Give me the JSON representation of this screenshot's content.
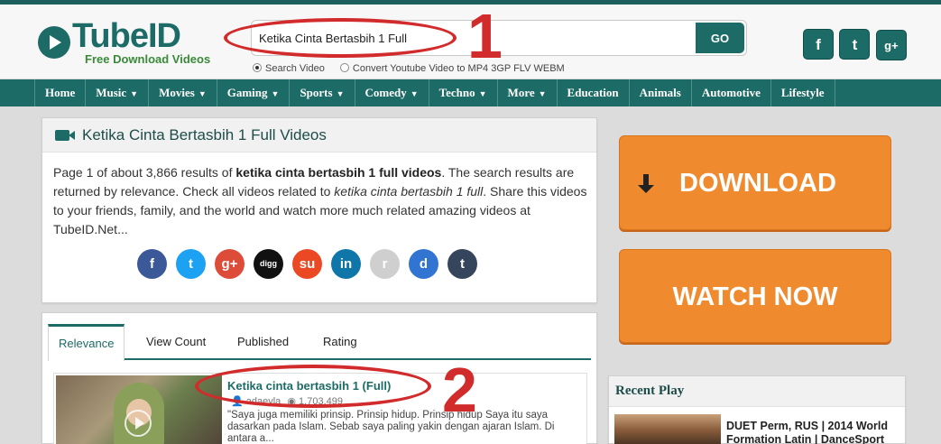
{
  "brand": {
    "name_part1": "Tube",
    "name_part2": "ID",
    "tagline": "Free Download Videos"
  },
  "search": {
    "value": "Ketika Cinta Bertasbih 1 Full",
    "go_label": "GO",
    "options": [
      {
        "label": "Search Video",
        "selected": true
      },
      {
        "label": "Convert Youtube Video to MP4 3GP FLV WEBM",
        "selected": false
      }
    ]
  },
  "social_top": [
    "f",
    "t",
    "g+"
  ],
  "nav": {
    "items": [
      {
        "label": "Home",
        "dropdown": false
      },
      {
        "label": "Music",
        "dropdown": true
      },
      {
        "label": "Movies",
        "dropdown": true
      },
      {
        "label": "Gaming",
        "dropdown": true
      },
      {
        "label": "Sports",
        "dropdown": true
      },
      {
        "label": "Comedy",
        "dropdown": true
      },
      {
        "label": "Techno",
        "dropdown": true
      },
      {
        "label": "More",
        "dropdown": true
      },
      {
        "label": "Education",
        "dropdown": false
      },
      {
        "label": "Animals",
        "dropdown": false
      },
      {
        "label": "Automotive",
        "dropdown": false
      },
      {
        "label": "Lifestyle",
        "dropdown": false
      }
    ],
    "caret": "▼"
  },
  "results": {
    "title": "Ketika Cinta Bertasbih 1 Full Videos",
    "summary_prefix": "Page 1 of about 3,866 results of ",
    "summary_query": "ketika cinta bertasbih 1 full videos",
    "summary_mid": ". The search results are returned by relevance. Check all videos related to ",
    "summary_query_italic": "ketika cinta bertasbih 1 full",
    "summary_suffix": ". Share this videos to your friends, family, and the world and watch more much related amazing videos at TubeID.Net...",
    "share_buttons": [
      {
        "name": "facebook",
        "glyph": "f",
        "color": "#3b5998"
      },
      {
        "name": "twitter",
        "glyph": "t",
        "color": "#1da1f2"
      },
      {
        "name": "googleplus",
        "glyph": "g+",
        "color": "#dd4b39"
      },
      {
        "name": "digg",
        "glyph": "digg",
        "color": "#111111"
      },
      {
        "name": "stumbleupon",
        "glyph": "su",
        "color": "#eb4924"
      },
      {
        "name": "linkedin",
        "glyph": "in",
        "color": "#0e76a8"
      },
      {
        "name": "reddit",
        "glyph": "r",
        "color": "#cfcfcf"
      },
      {
        "name": "delicious",
        "glyph": "d",
        "color": "#3274d1"
      },
      {
        "name": "tumblr",
        "glyph": "t",
        "color": "#35465c"
      }
    ]
  },
  "tabs": [
    {
      "label": "Relevance",
      "active": true
    },
    {
      "label": "View Count",
      "active": false
    },
    {
      "label": "Published",
      "active": false
    },
    {
      "label": "Rating",
      "active": false
    }
  ],
  "videos": [
    {
      "title": "Ketika cinta bertasbih 1 (Full)",
      "author": "adaeyla",
      "views": "1,703,499",
      "description": "\"Saya juga memiliki prinsip. Prinsip hidup. Prinsip hidup Saya itu saya dasarkan pada Islam. Sebab saya paling yakin dengan ajaran Islam. Di antara a..."
    }
  ],
  "sidebar": {
    "download_label": "DOWNLOAD",
    "watch_label": "WATCH NOW",
    "recent_title": "Recent Play",
    "recent_items": [
      {
        "title": "DUET Perm, RUS | 2014 World Formation Latin | DanceSport"
      }
    ]
  },
  "annotations": [
    {
      "number": "1"
    },
    {
      "number": "2"
    }
  ],
  "colors": {
    "brand_teal": "#1d6b66",
    "accent_orange": "#f08a2e",
    "annotation_red": "#d22b2b"
  }
}
